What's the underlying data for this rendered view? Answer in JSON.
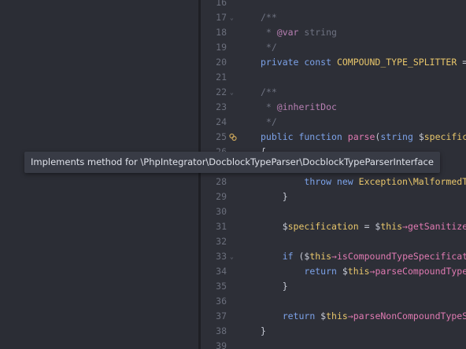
{
  "tooltip": {
    "text": "Implements method for \\PhpIntegrator\\DocblockTypeParser\\DocblockTypeParserInterface"
  },
  "gutter_icon": "implements-icon",
  "lines": [
    {
      "n": "16",
      "fold": false,
      "parts": []
    },
    {
      "n": "17",
      "fold": true,
      "parts": [
        {
          "c": "cm",
          "t": "/**"
        }
      ]
    },
    {
      "n": "18",
      "fold": false,
      "parts": [
        {
          "c": "cm",
          "t": " * "
        },
        {
          "c": "tag",
          "t": "@var"
        },
        {
          "c": "cm",
          "t": " string"
        }
      ]
    },
    {
      "n": "19",
      "fold": false,
      "parts": [
        {
          "c": "cm",
          "t": " */"
        }
      ]
    },
    {
      "n": "20",
      "fold": false,
      "parts": [
        {
          "c": "kw",
          "t": "private const "
        },
        {
          "c": "const",
          "t": "COMPOUND_TYPE_SPLITTER"
        },
        {
          "c": "type",
          "t": " = "
        },
        {
          "c": "str",
          "t": "'"
        }
      ]
    },
    {
      "n": "21",
      "fold": false,
      "parts": []
    },
    {
      "n": "22",
      "fold": true,
      "parts": [
        {
          "c": "cm",
          "t": "/**"
        }
      ]
    },
    {
      "n": "23",
      "fold": false,
      "parts": [
        {
          "c": "cm",
          "t": " * "
        },
        {
          "c": "tag",
          "t": "@inheritDoc"
        }
      ]
    },
    {
      "n": "24",
      "fold": false,
      "parts": [
        {
          "c": "cm",
          "t": " */"
        }
      ]
    },
    {
      "n": "25",
      "fold": false,
      "icon": true,
      "parts": [
        {
          "c": "kw",
          "t": "public function "
        },
        {
          "c": "fn",
          "t": "parse"
        },
        {
          "c": "type",
          "t": "("
        },
        {
          "c": "kw",
          "t": "string "
        },
        {
          "c": "type",
          "t": "$"
        },
        {
          "c": "var",
          "t": "specificat"
        }
      ]
    },
    {
      "n": "26",
      "fold": false,
      "parts": [
        {
          "c": "type",
          "t": "{"
        }
      ]
    },
    {
      "n": "27",
      "fold": false,
      "parts": []
    },
    {
      "n": "28",
      "fold": false,
      "parts": [
        {
          "c": "type",
          "t": "        "
        },
        {
          "c": "kw",
          "t": "throw new "
        },
        {
          "c": "cls",
          "t": "Exception\\MalformedTyp"
        }
      ]
    },
    {
      "n": "29",
      "fold": false,
      "parts": [
        {
          "c": "type",
          "t": "    }"
        }
      ]
    },
    {
      "n": "30",
      "fold": false,
      "parts": []
    },
    {
      "n": "31",
      "fold": false,
      "parts": [
        {
          "c": "type",
          "t": "    $"
        },
        {
          "c": "var",
          "t": "specification"
        },
        {
          "c": "type",
          "t": " = $"
        },
        {
          "c": "var",
          "t": "this"
        },
        {
          "c": "arr",
          "t": "→"
        },
        {
          "c": "fn",
          "t": "getSanitized"
        }
      ]
    },
    {
      "n": "32",
      "fold": false,
      "parts": []
    },
    {
      "n": "33",
      "fold": true,
      "parts": [
        {
          "c": "type",
          "t": "    "
        },
        {
          "c": "kw",
          "t": "if "
        },
        {
          "c": "type",
          "t": "($"
        },
        {
          "c": "var",
          "t": "this"
        },
        {
          "c": "arr",
          "t": "→"
        },
        {
          "c": "fn",
          "t": "isCompoundTypeSpecificati"
        }
      ]
    },
    {
      "n": "34",
      "fold": false,
      "parts": [
        {
          "c": "type",
          "t": "        "
        },
        {
          "c": "kw",
          "t": "return "
        },
        {
          "c": "type",
          "t": "$"
        },
        {
          "c": "var",
          "t": "this"
        },
        {
          "c": "arr",
          "t": "→"
        },
        {
          "c": "fn",
          "t": "parseCompoundType"
        }
      ]
    },
    {
      "n": "35",
      "fold": false,
      "parts": [
        {
          "c": "type",
          "t": "    }"
        }
      ]
    },
    {
      "n": "36",
      "fold": false,
      "parts": []
    },
    {
      "n": "37",
      "fold": false,
      "parts": [
        {
          "c": "type",
          "t": "    "
        },
        {
          "c": "kw",
          "t": "return "
        },
        {
          "c": "type",
          "t": "$"
        },
        {
          "c": "var",
          "t": "this"
        },
        {
          "c": "arr",
          "t": "→"
        },
        {
          "c": "fn",
          "t": "parseNonCompoundTypeSp"
        }
      ]
    },
    {
      "n": "38",
      "fold": false,
      "parts": [
        {
          "c": "type",
          "t": "}"
        }
      ]
    },
    {
      "n": "39",
      "fold": false,
      "parts": []
    }
  ]
}
